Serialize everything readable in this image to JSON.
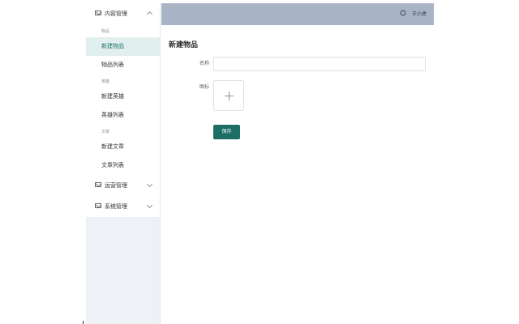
{
  "sidebar": {
    "menus": [
      {
        "label": "内容管理",
        "icon": "mail-icon",
        "expanded": true,
        "groups": [
          {
            "title": "物品",
            "items": [
              {
                "label": "新建物品",
                "active": true
              },
              {
                "label": "物品列表"
              }
            ]
          },
          {
            "title": "英雄",
            "items": [
              {
                "label": "新建英雄"
              },
              {
                "label": "英雄列表"
              }
            ]
          },
          {
            "title": "文章",
            "items": [
              {
                "label": "新建文章"
              },
              {
                "label": "文章列表"
              }
            ]
          }
        ]
      },
      {
        "label": "运营管理",
        "icon": "mail-icon",
        "expanded": false
      },
      {
        "label": "系统管理",
        "icon": "mail-icon",
        "expanded": false
      }
    ]
  },
  "header": {
    "username": "王小虎",
    "icon": "gear-icon"
  },
  "main": {
    "title": "新建物品",
    "form": {
      "name_label": "名称",
      "name_value": "",
      "icon_label": "图标",
      "save_label": "保存"
    }
  },
  "colors": {
    "accent": "#1b6f65",
    "header_bg": "#a8b4c6",
    "sidebar_bg": "#eef1f6",
    "active_item_bg": "#e1f0ee"
  }
}
